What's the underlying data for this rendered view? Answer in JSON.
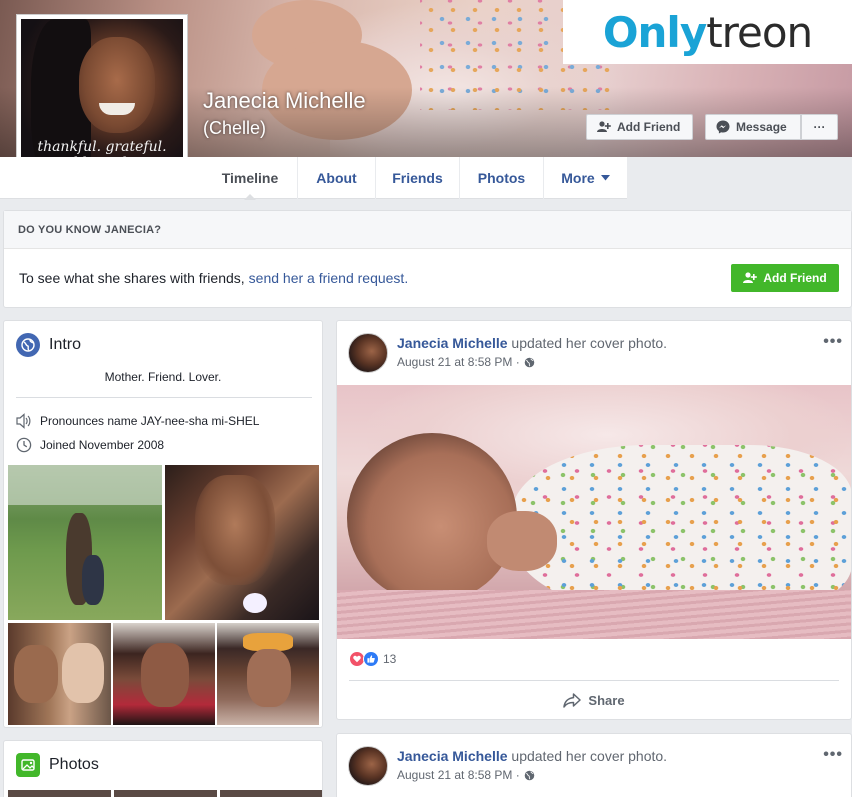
{
  "watermark": {
    "part1": "Only",
    "part2": "treon"
  },
  "profile": {
    "name": "Janecia Michelle",
    "alternate_name": "(Chelle)",
    "picture_caption": "thankful. grateful. blessed."
  },
  "actions": {
    "add_friend": "Add Friend",
    "message": "Message",
    "more": "···"
  },
  "nav": {
    "tabs": [
      {
        "label": "Timeline"
      },
      {
        "label": "About"
      },
      {
        "label": "Friends"
      },
      {
        "label": "Photos"
      },
      {
        "label": "More"
      }
    ]
  },
  "know_box": {
    "heading": "DO YOU KNOW JANECIA?",
    "text": "To see what she shares with friends,",
    "link": "send her a friend request.",
    "button": "Add Friend"
  },
  "intro": {
    "title": "Intro",
    "bio": "Mother. Friend. Lover.",
    "pronounce": "Pronounces name JAY-nee-sha mi-SHEL",
    "joined": "Joined November 2008"
  },
  "photos_card": {
    "title": "Photos"
  },
  "posts": [
    {
      "author": "Janecia Michelle",
      "action": "updated her cover photo.",
      "timestamp": "August 21 at 8:58 PM ·",
      "options": "•••",
      "reaction_count": "13",
      "share_label": "Share"
    },
    {
      "author": "Janecia Michelle",
      "action": "updated her cover photo.",
      "timestamp": "August 21 at 8:58 PM ·",
      "options": "•••"
    }
  ],
  "colors": {
    "link": "#365899",
    "green": "#42b72a",
    "background": "#e9ebee"
  }
}
